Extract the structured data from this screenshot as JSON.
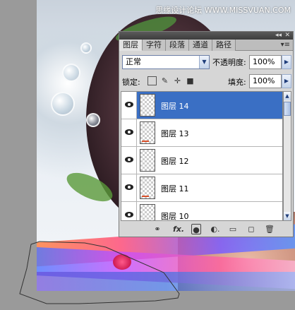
{
  "watermark": "思缘设计论坛  WWW.MISSVUAN.COM",
  "panel": {
    "tabs": [
      "图层",
      "字符",
      "段落",
      "通道",
      "路径"
    ],
    "active_tab": 0,
    "collapse_icon": "double-chevron-icon",
    "close_icon": "close-icon",
    "menu_icon": "panel-menu-icon",
    "blend_mode": "正常",
    "opacity_label": "不透明度:",
    "opacity_value": "100%",
    "lock_label": "锁定:",
    "lock_icons": [
      "lock-transparent-icon",
      "lock-paint-icon",
      "lock-move-icon",
      "lock-all-icon"
    ],
    "fill_label": "填充:",
    "fill_value": "100%",
    "layers": [
      {
        "name": "图层 14",
        "selected": true
      },
      {
        "name": "图层 13",
        "selected": false
      },
      {
        "name": "图层 12",
        "selected": false
      },
      {
        "name": "图层 11",
        "selected": false
      },
      {
        "name": "图层 10",
        "selected": false
      }
    ],
    "footer_buttons": [
      "link-icon",
      "fx-icon",
      "mask-icon",
      "adjustment-icon",
      "group-icon",
      "new-layer-icon",
      "trash-icon"
    ],
    "footer_labels": {
      "fx": "fx."
    }
  },
  "colors": {
    "selected_layer": "#3a6fc4",
    "panel_bg": "#d6d6d6"
  }
}
